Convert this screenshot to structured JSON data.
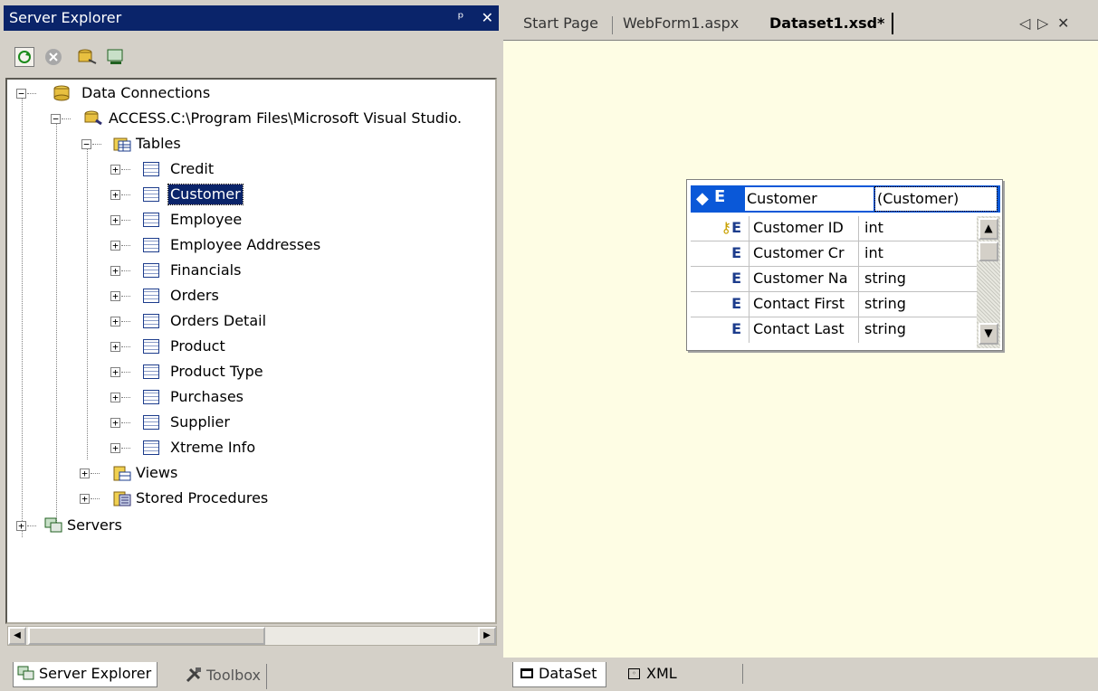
{
  "server_explorer": {
    "title": "Server Explorer",
    "pin_glyph": "ᵖ",
    "close_glyph": "✕",
    "toolbar": [
      "refresh-icon",
      "stop-icon",
      "connect-database-icon",
      "connect-server-icon"
    ],
    "tree": {
      "data_connections": "Data Connections",
      "connection": "ACCESS.C:\\Program Files\\Microsoft Visual Studio.",
      "tables_folder": "Tables",
      "tables": [
        "Credit",
        "Customer",
        "Employee",
        "Employee Addresses",
        "Financials",
        "Orders",
        "Orders Detail",
        "Product",
        "Product Type",
        "Purchases",
        "Supplier",
        "Xtreme Info"
      ],
      "selected_table": "Customer",
      "views": "Views",
      "stored_procedures": "Stored Procedures",
      "servers": "Servers"
    },
    "tabs": {
      "active": "Server Explorer",
      "inactive": "Toolbox"
    }
  },
  "document_tabs": {
    "tabs": [
      "Start Page",
      "WebForm1.aspx",
      "Dataset1.xsd*"
    ],
    "active": "Dataset1.xsd*",
    "nav": {
      "left": "◁",
      "right": "▷",
      "close": "✕"
    }
  },
  "entity": {
    "marker": "E",
    "name": "Customer",
    "type": "(Customer)",
    "rows": [
      {
        "marker": "E",
        "name": "Customer ID",
        "type": "int",
        "key": true
      },
      {
        "marker": "E",
        "name": "Customer Cr",
        "type": "int",
        "key": false
      },
      {
        "marker": "E",
        "name": "Customer Na",
        "type": "string",
        "key": false
      },
      {
        "marker": "E",
        "name": "Contact First",
        "type": "string",
        "key": false
      },
      {
        "marker": "E",
        "name": "Contact Last",
        "type": "string",
        "key": false
      }
    ]
  },
  "bottom_tabs": {
    "dataset": "DataSet",
    "xml": "XML"
  },
  "colors": {
    "title_bar": "#0a246a",
    "canvas": "#fefde4",
    "entity_header": "#0a58d8"
  }
}
